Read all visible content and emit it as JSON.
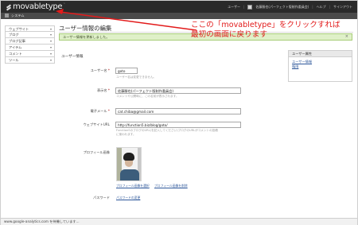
{
  "header": {
    "logo_text": "movabletype",
    "logo_tm": "™",
    "nav": {
      "user_label": "ユーザー",
      "user_name": "佐藤勝也(パーフェクト版制作委員会)",
      "help": "ヘルプ",
      "sign_out": "サインアウト"
    },
    "system_label": "システム"
  },
  "sidebar": {
    "items": [
      {
        "label": "ウェブサイト"
      },
      {
        "label": "ブログ"
      },
      {
        "label": "ブログ記事"
      },
      {
        "label": "アイテム"
      },
      {
        "label": "コメント"
      },
      {
        "label": "ツール"
      }
    ]
  },
  "page": {
    "title": "ユーザー情報の編集",
    "success_message": "ユーザー情報を更新しました。",
    "close": "×",
    "section_title": "ユーザー情報"
  },
  "form": {
    "username": {
      "label": "ユーザー名",
      "required": "*",
      "value": "goto",
      "help": "ユーザー名は変更できません。"
    },
    "display_name": {
      "label": "表示名",
      "required": "*",
      "value": "佐藤勝也(パーフェクト版制作委員会)",
      "help": "コメントや公開時に、この名前が表示されます。"
    },
    "email": {
      "label": "電子メール",
      "required": "*",
      "value": "cat.chiba@gmail.com"
    },
    "website_url": {
      "label": "ウェブサイトURL",
      "value": "http://function5.biz/blog/goto/",
      "help_line1": "FunctionSのブログのURL(を記入してください)ブログのURLがコメントの投稿",
      "help_line2": "に使われます。"
    },
    "profile_image": {
      "label": "プロフィール画像",
      "change_link": "プロフィール画像を選択",
      "delete_link": "プロフィール画像を削除"
    },
    "password": {
      "label": "パスワード",
      "change_link": "パスワードの変更"
    }
  },
  "right_panel": {
    "title": "ユーザー属性",
    "links": [
      "ユーザー情報",
      "権限"
    ]
  },
  "annotation": {
    "line1": "ここの「movabletype」をクリックすれば",
    "line2": "最初の画面に戻ります",
    "color": "#e21a1a"
  },
  "status_bar": {
    "text": "www.google-analytics.com を待機しています..."
  }
}
